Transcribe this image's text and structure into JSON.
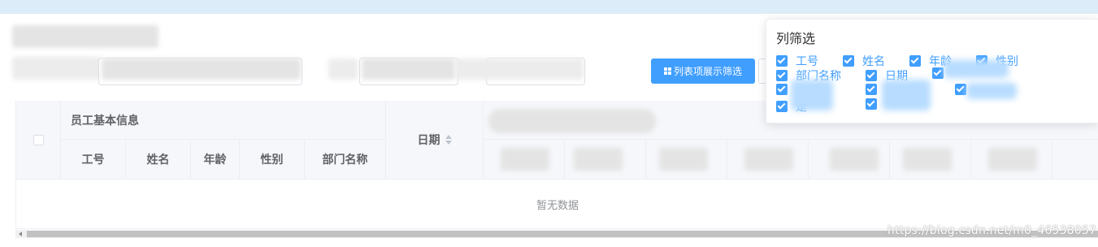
{
  "popover": {
    "title": "列筛选",
    "options": [
      {
        "label": "工号",
        "checked": true
      },
      {
        "label": "姓名",
        "checked": true
      },
      {
        "label": "年龄",
        "checked": true
      },
      {
        "label": "性别",
        "checked": true
      },
      {
        "label": "部门名称",
        "checked": true
      },
      {
        "label": "日期",
        "checked": true
      },
      {
        "label": "",
        "checked": true
      },
      {
        "label": "",
        "checked": true
      },
      {
        "label": "",
        "checked": true
      },
      {
        "label": "",
        "checked": true
      },
      {
        "label": "是",
        "checked": true
      },
      {
        "label": "",
        "checked": true
      }
    ]
  },
  "toolbar": {
    "column_filter_button": "列表项展示筛选"
  },
  "table": {
    "group_header": "员工基本信息",
    "columns": [
      "工号",
      "姓名",
      "年龄",
      "性别",
      "部门名称"
    ],
    "date_header": "日期",
    "empty_text": "暂无数据"
  },
  "watermark": "https://blog.csdn.net/m0_46538057",
  "colors": {
    "accent": "#409eff",
    "header_bg": "#f5f7fa",
    "border": "#ebeef5"
  }
}
